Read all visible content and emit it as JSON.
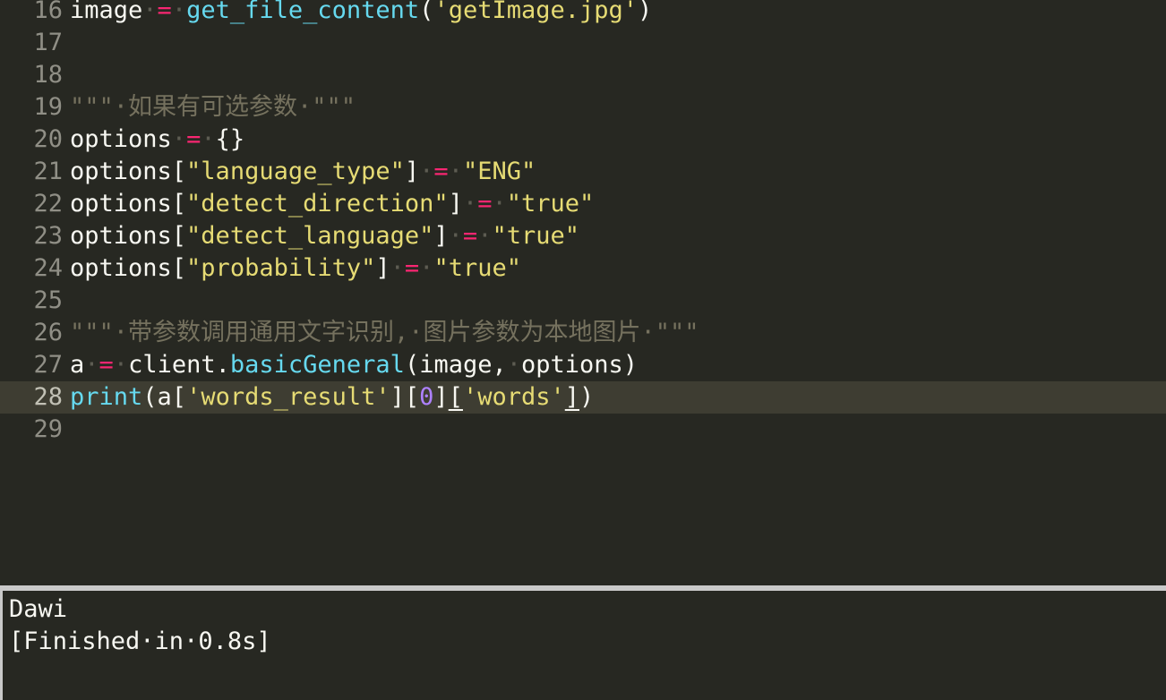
{
  "editor": {
    "current_line": "28",
    "lines": [
      {
        "num": "16",
        "tokens": [
          {
            "t": "image",
            "c": "plain"
          },
          {
            "t": "·",
            "c": "ws"
          },
          {
            "t": "=",
            "c": "op"
          },
          {
            "t": "·",
            "c": "ws"
          },
          {
            "t": "get_file_content",
            "c": "func"
          },
          {
            "t": "(",
            "c": "plain"
          },
          {
            "t": "'getImage.jpg'",
            "c": "string"
          },
          {
            "t": ")",
            "c": "plain"
          }
        ]
      },
      {
        "num": "17",
        "tokens": []
      },
      {
        "num": "18",
        "tokens": []
      },
      {
        "num": "19",
        "tokens": [
          {
            "t": "\"\"\"·如果有可选参数·\"\"\"",
            "c": "comment"
          }
        ]
      },
      {
        "num": "20",
        "tokens": [
          {
            "t": "options",
            "c": "plain"
          },
          {
            "t": "·",
            "c": "ws"
          },
          {
            "t": "=",
            "c": "op"
          },
          {
            "t": "·",
            "c": "ws"
          },
          {
            "t": "{}",
            "c": "plain"
          }
        ]
      },
      {
        "num": "21",
        "tokens": [
          {
            "t": "options[",
            "c": "plain"
          },
          {
            "t": "\"language_type\"",
            "c": "string"
          },
          {
            "t": "]",
            "c": "plain"
          },
          {
            "t": "·",
            "c": "ws"
          },
          {
            "t": "=",
            "c": "op"
          },
          {
            "t": "·",
            "c": "ws"
          },
          {
            "t": "\"ENG\"",
            "c": "string"
          }
        ]
      },
      {
        "num": "22",
        "tokens": [
          {
            "t": "options[",
            "c": "plain"
          },
          {
            "t": "\"detect_direction\"",
            "c": "string"
          },
          {
            "t": "]",
            "c": "plain"
          },
          {
            "t": "·",
            "c": "ws"
          },
          {
            "t": "=",
            "c": "op"
          },
          {
            "t": "·",
            "c": "ws"
          },
          {
            "t": "\"true\"",
            "c": "string"
          }
        ]
      },
      {
        "num": "23",
        "tokens": [
          {
            "t": "options[",
            "c": "plain"
          },
          {
            "t": "\"detect_language\"",
            "c": "string"
          },
          {
            "t": "]",
            "c": "plain"
          },
          {
            "t": "·",
            "c": "ws"
          },
          {
            "t": "=",
            "c": "op"
          },
          {
            "t": "·",
            "c": "ws"
          },
          {
            "t": "\"true\"",
            "c": "string"
          }
        ]
      },
      {
        "num": "24",
        "tokens": [
          {
            "t": "options[",
            "c": "plain"
          },
          {
            "t": "\"probability\"",
            "c": "string"
          },
          {
            "t": "]",
            "c": "plain"
          },
          {
            "t": "·",
            "c": "ws"
          },
          {
            "t": "=",
            "c": "op"
          },
          {
            "t": "·",
            "c": "ws"
          },
          {
            "t": "\"true\"",
            "c": "string"
          }
        ]
      },
      {
        "num": "25",
        "tokens": []
      },
      {
        "num": "26",
        "tokens": [
          {
            "t": "\"\"\"·带参数调用通用文字识别,·图片参数为本地图片·\"\"\"",
            "c": "comment"
          }
        ]
      },
      {
        "num": "27",
        "tokens": [
          {
            "t": "a",
            "c": "plain"
          },
          {
            "t": "·",
            "c": "ws"
          },
          {
            "t": "=",
            "c": "op"
          },
          {
            "t": "·",
            "c": "ws"
          },
          {
            "t": "client.",
            "c": "plain"
          },
          {
            "t": "basicGeneral",
            "c": "func"
          },
          {
            "t": "(image,",
            "c": "plain"
          },
          {
            "t": "·",
            "c": "ws"
          },
          {
            "t": "options)",
            "c": "plain"
          }
        ]
      },
      {
        "num": "28",
        "tokens": [
          {
            "t": "print",
            "c": "func"
          },
          {
            "t": "(a[",
            "c": "plain"
          },
          {
            "t": "'words_result'",
            "c": "string"
          },
          {
            "t": "][",
            "c": "plain"
          },
          {
            "t": "0",
            "c": "num"
          },
          {
            "t": "]",
            "c": "plain"
          },
          {
            "t": "[",
            "c": "bracket-match"
          },
          {
            "t": "'words'",
            "c": "string"
          },
          {
            "t": "]",
            "c": "bracket-match"
          },
          {
            "t": ")",
            "c": "plain"
          }
        ]
      },
      {
        "num": "29",
        "tokens": []
      }
    ]
  },
  "output": {
    "lines": [
      "Dawi",
      "[Finished·in·0.8s]"
    ]
  }
}
